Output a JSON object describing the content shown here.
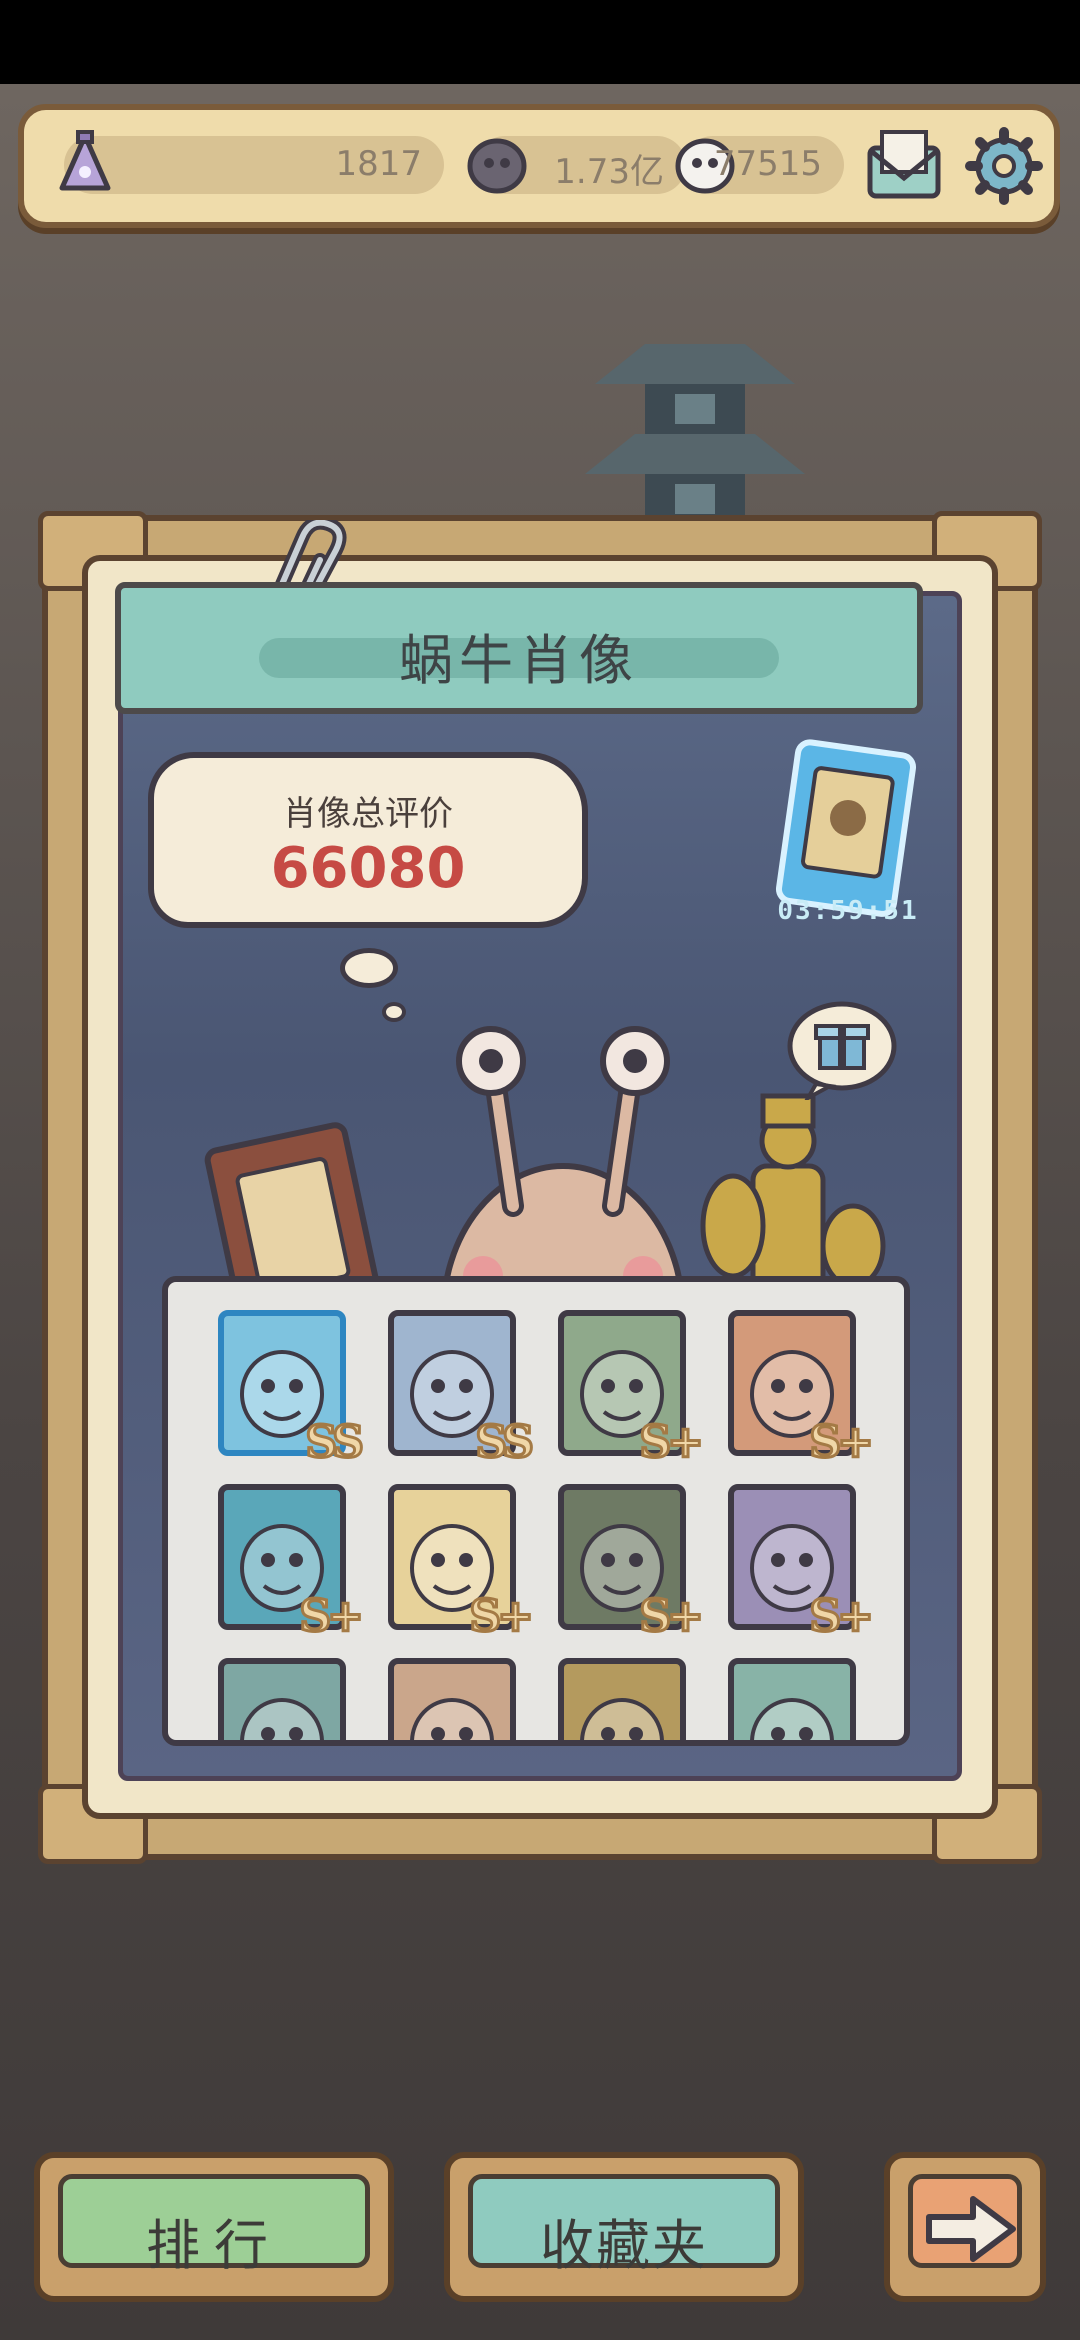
{
  "topbar": {
    "resources": [
      {
        "icon": "potion-flask-icon",
        "value": "1817"
      },
      {
        "icon": "dark-orb-icon",
        "value": "1.73亿"
      },
      {
        "icon": "white-orb-icon",
        "value": "77515"
      }
    ],
    "mail_icon": "mail-icon",
    "settings_icon": "gear-icon"
  },
  "panel": {
    "title": "蜗牛肖像",
    "rating_label": "肖像总评价",
    "rating_value": "66080",
    "timer": "03:59:51",
    "gift_icon": "gift-icon"
  },
  "portraits": [
    {
      "rank": "SS",
      "bg": "#7ec3df",
      "selected": true
    },
    {
      "rank": "SS",
      "bg": "#9fb5cf",
      "selected": false
    },
    {
      "rank": "S+",
      "bg": "#8fa98b",
      "selected": false
    },
    {
      "rank": "S+",
      "bg": "#d39a7a",
      "selected": false
    },
    {
      "rank": "S+",
      "bg": "#5aa7b9",
      "selected": false
    },
    {
      "rank": "S+",
      "bg": "#e7d29a",
      "selected": false
    },
    {
      "rank": "S+",
      "bg": "#6e7a64",
      "selected": false
    },
    {
      "rank": "S+",
      "bg": "#9b8fb6",
      "selected": false
    },
    {
      "rank": "",
      "bg": "#7ea7a3",
      "selected": false
    },
    {
      "rank": "",
      "bg": "#caa68b",
      "selected": false
    },
    {
      "rank": "",
      "bg": "#b49a5e",
      "selected": false
    },
    {
      "rank": "",
      "bg": "#88b3a7",
      "selected": false
    }
  ],
  "bottom": {
    "rank_label": "排行",
    "collection_label": "收藏夹",
    "next_icon": "arrow-right-icon"
  },
  "colors": {
    "rating_red": "#c64a44",
    "banner_teal": "#8fcbbf",
    "rank_button_green": "#9dcf96",
    "collection_button_teal": "#8fcbbf",
    "next_button_orange": "#e9a274"
  }
}
